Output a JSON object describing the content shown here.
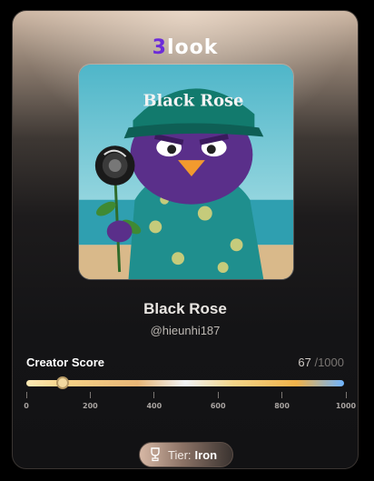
{
  "brand": {
    "logo_prefix": "3",
    "logo_suffix": "look"
  },
  "profile": {
    "name": "Black Rose",
    "handle": "@hieunhi187",
    "avatar": {
      "icon": "avatar-image",
      "hat_text": "Black Rose"
    }
  },
  "score": {
    "label": "Creator Score",
    "value": "67",
    "max": "/1000",
    "progress_fraction": 0.067,
    "scale_ticks": [
      "0",
      "200",
      "400",
      "600",
      "800",
      "1000"
    ]
  },
  "tier": {
    "label": "Tier:",
    "value": "Iron",
    "icon": "trophy-icon"
  },
  "colors": {
    "brand_accent": "#6c2bd9",
    "card_bg": "#141416"
  }
}
